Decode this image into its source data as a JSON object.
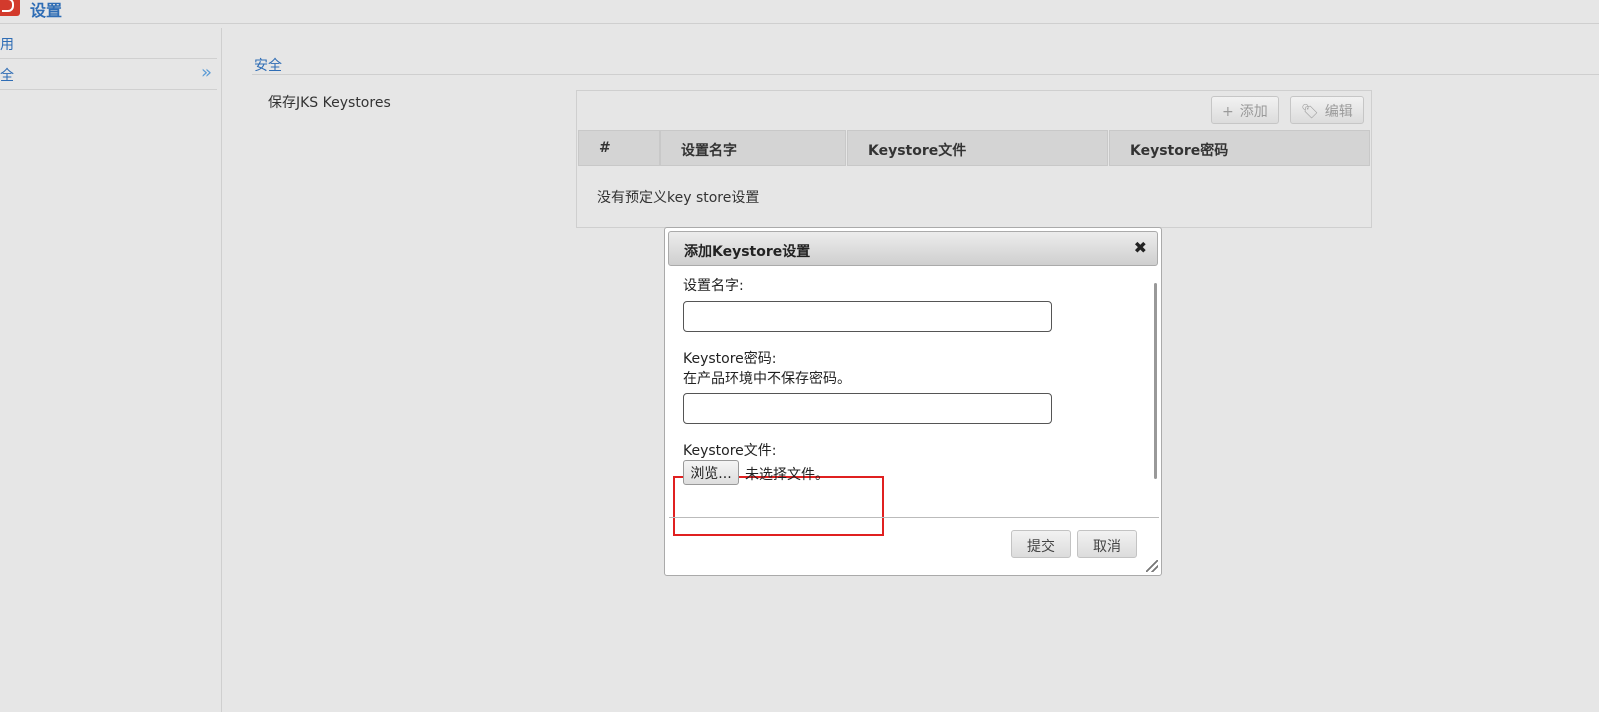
{
  "header": {
    "title": "设置",
    "logo_icon": "app-logo-icon"
  },
  "sidebar": {
    "items": [
      {
        "label": "用"
      },
      {
        "label": "全",
        "chevron": "»"
      }
    ]
  },
  "main": {
    "section_title": "安全",
    "field_label": "保存JKS Keystores",
    "toolbar": {
      "add_icon": "+",
      "add_label": "添加",
      "edit_icon": "🏷",
      "edit_label": "编辑"
    },
    "columns": [
      "#",
      "设置名字",
      "Keystore文件",
      "Keystore密码"
    ],
    "empty_message": "没有预定义key store设置"
  },
  "dialog": {
    "title": "添加Keystore设置",
    "close_icon": "✖",
    "name_label": "设置名字:",
    "name_value": "",
    "password_label": "Keystore密码:",
    "password_hint": "在产品环境中不保存密码。",
    "password_value": "",
    "file_label": "Keystore文件:",
    "browse_label": "浏览...",
    "file_status": "未选择文件。",
    "submit_label": "提交",
    "cancel_label": "取消"
  },
  "colors": {
    "accent": "#2f6db5",
    "highlight": "#e02020",
    "background": "#e6e6e6"
  }
}
